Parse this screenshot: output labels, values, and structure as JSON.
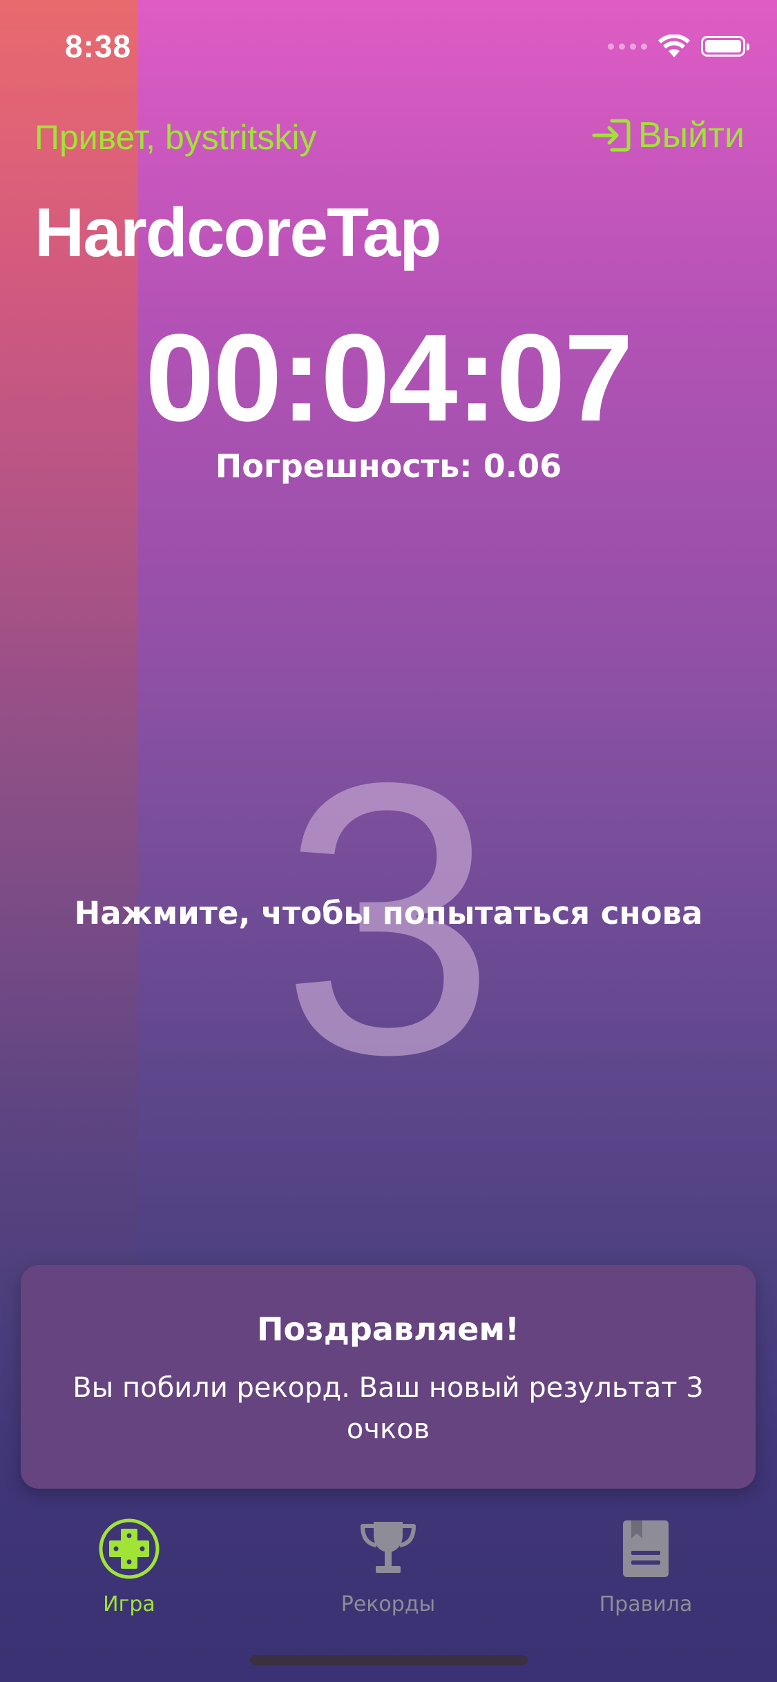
{
  "status_bar": {
    "time": "8:38"
  },
  "header": {
    "greeting": "Привет, bystritskiy",
    "logout_label": "Выйти",
    "title": "HardcoreTap"
  },
  "game": {
    "timer": "00:04:07",
    "error": "Погрешность: 0.06",
    "score": "3",
    "hint": "Нажмите, чтобы попытаться снова"
  },
  "toast": {
    "title": "Поздравляем!",
    "body": "Вы побили рекорд. Ваш новый результат 3 очков"
  },
  "tabs": [
    {
      "label": "Игра",
      "icon": "gamepad-icon",
      "active": true
    },
    {
      "label": "Рекорды",
      "icon": "trophy-icon",
      "active": false
    },
    {
      "label": "Правила",
      "icon": "book-icon",
      "active": false
    }
  ],
  "colors": {
    "accent": "#a0e436",
    "inactive_tab": "#8e8c96",
    "toast_bg": "#664480"
  }
}
